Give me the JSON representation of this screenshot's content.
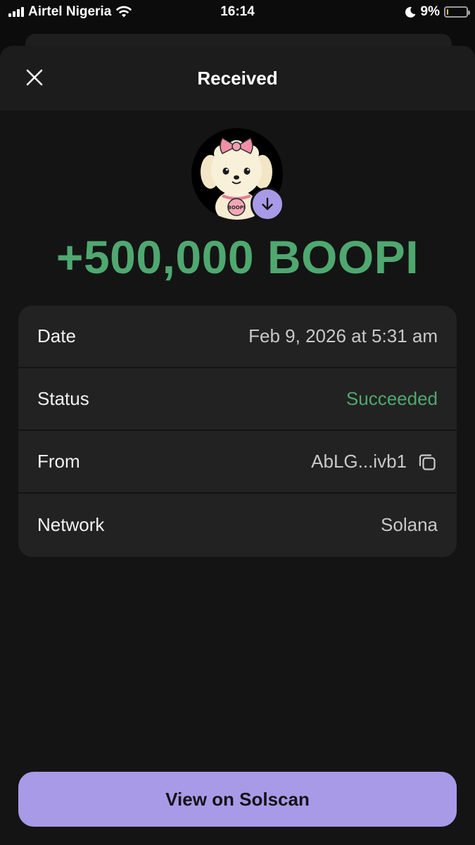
{
  "status_bar": {
    "carrier": "Airtel Nigeria",
    "time": "16:14",
    "battery": "9%",
    "battery_level": 0.09
  },
  "header": {
    "title": "Received",
    "close_icon": "close-icon"
  },
  "token": {
    "avatar_icon": "boopi-dog-logo",
    "avatar_text": "BOOPI",
    "badge_icon": "arrow-down-icon"
  },
  "amount": "+500,000 BOOPI",
  "details": [
    {
      "label": "Date",
      "value": "Feb 9, 2026 at 5:31 am"
    },
    {
      "label": "Status",
      "value": "Succeeded"
    },
    {
      "label": "From",
      "value": "AbLG...ivb1"
    },
    {
      "label": "Network",
      "value": "Solana"
    }
  ],
  "actions": {
    "view_button": "View on Solscan"
  },
  "colors": {
    "accent_purple": "#a99ae8",
    "success_green": "#4fa870",
    "sheet_bg": "#141414",
    "card_bg": "#222222"
  }
}
